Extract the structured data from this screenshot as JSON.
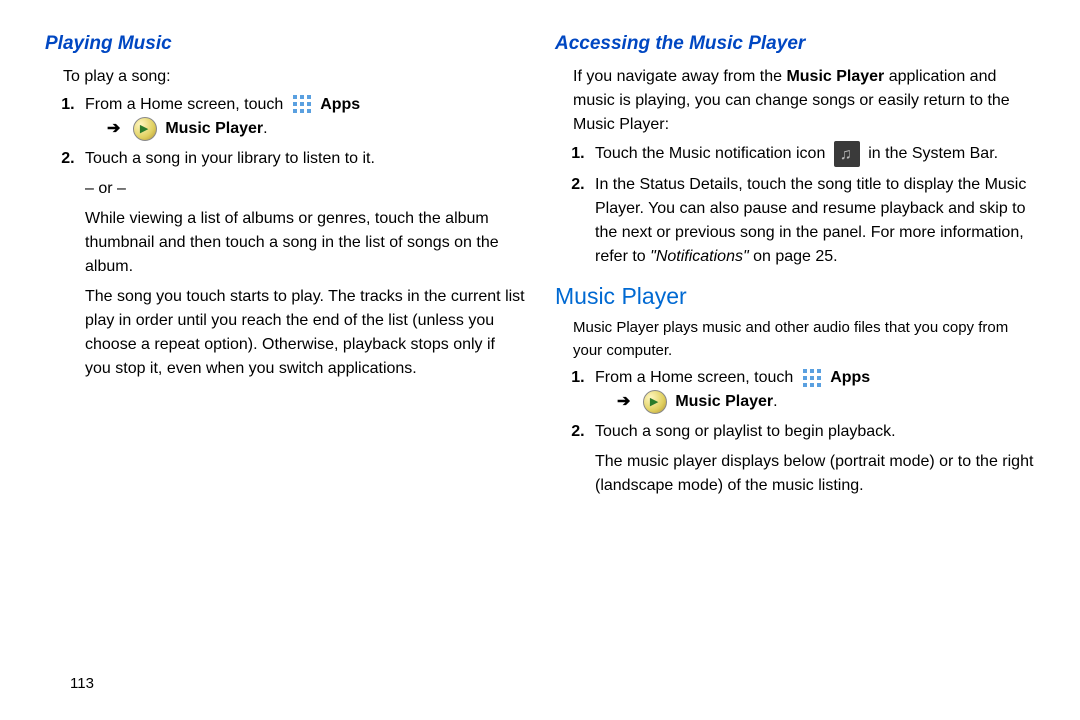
{
  "left": {
    "heading": "Playing Music",
    "intro": "To play a song:",
    "step1_a": "From a Home screen, touch ",
    "apps_label": "Apps",
    "arrow": "➔",
    "mp_label": "Music Player",
    "period": ".",
    "step2_a": "Touch a song in your library to listen to it.",
    "or": "– or –",
    "step2_b": "While viewing a list of albums or genres, touch the album thumbnail and then touch a song in the list of songs on the album.",
    "step2_c": "The song you touch starts to play. The tracks in the current list play in order until you reach the end of the list (unless you choose a repeat option). Otherwise, playback stops only if you stop it, even when you switch applications."
  },
  "right": {
    "heading1": "Accessing the Music Player",
    "intro1_a": "If you navigate away from the ",
    "intro1_bold": "Music Player",
    "intro1_b": " application and music is playing, you can change songs or easily return to the Music Player:",
    "r1_step1_a": "Touch the Music notification icon ",
    "r1_step1_b": " in the System Bar.",
    "r1_step2_a": "In the Status Details, touch the song title to display the Music Player. You can also pause and resume playback and skip to the next or previous song in the panel. For more information, refer to ",
    "r1_step2_ref": "\"Notifications\"",
    "r1_step2_b": " on page 25.",
    "heading2": "Music Player",
    "intro2": "Music Player plays music and other audio files that you copy from your computer.",
    "r2_step1_a": "From a Home screen, touch ",
    "r2_step2": "Touch a song or playlist to begin playback.",
    "r2_note": "The music player displays below (portrait mode) or to the right (landscape mode) of the music listing."
  },
  "page_number": "113"
}
